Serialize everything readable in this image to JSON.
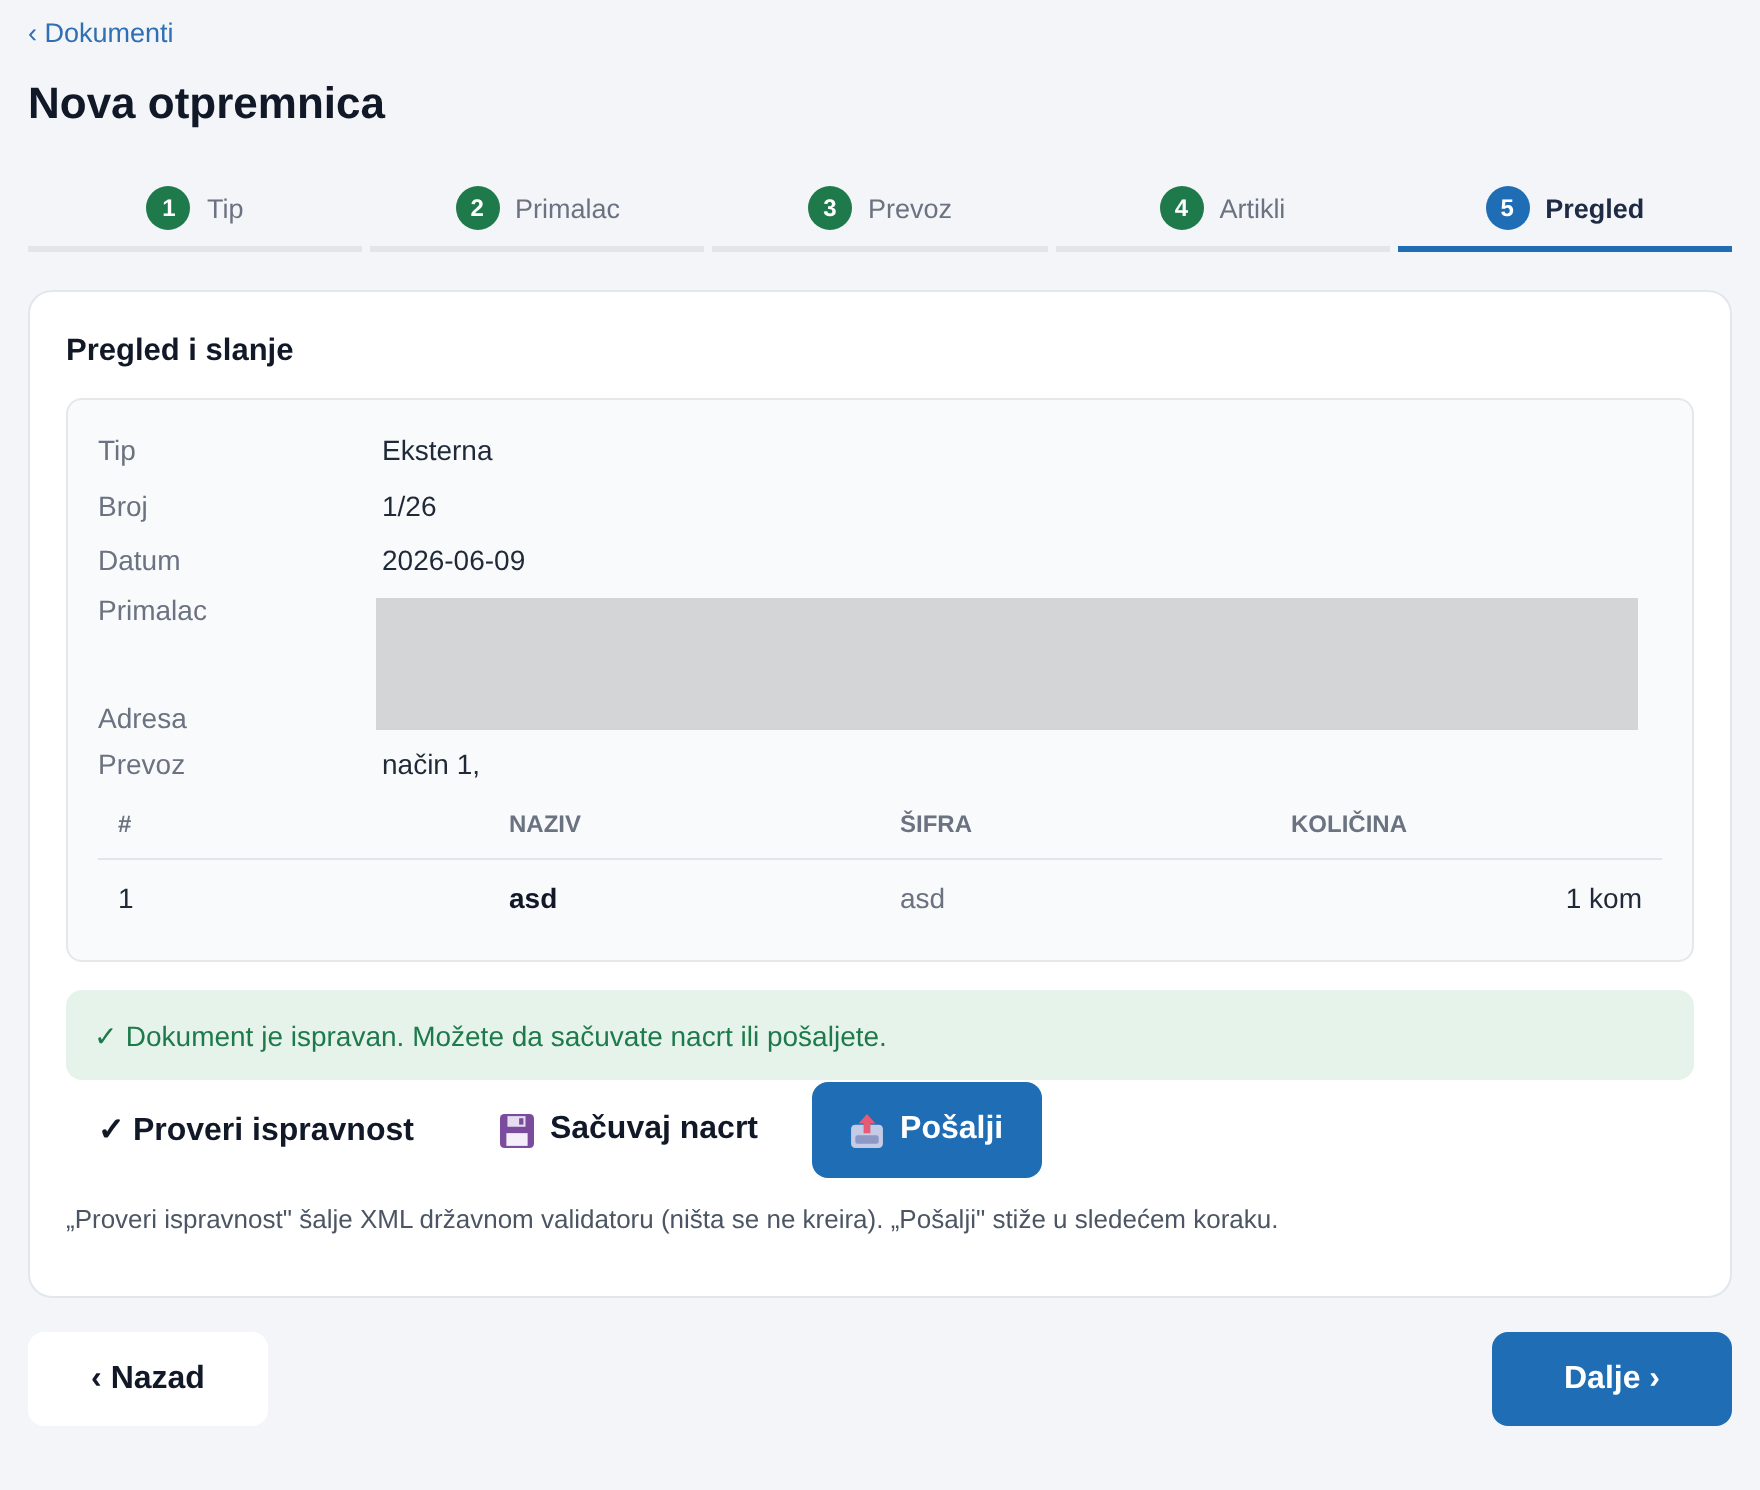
{
  "back_link": {
    "label": "‹ Dokumenti"
  },
  "title": "Nova otpremnica",
  "steps": [
    {
      "number": "1",
      "label": "Tip",
      "completed": true,
      "selected": false
    },
    {
      "number": "2",
      "label": "Primalac",
      "completed": true,
      "selected": false
    },
    {
      "number": "3",
      "label": "Prevoz",
      "completed": true,
      "selected": false
    },
    {
      "number": "4",
      "label": "Artikli",
      "completed": true,
      "selected": false
    },
    {
      "number": "5",
      "label": "Pregled",
      "completed": false,
      "selected": true
    }
  ],
  "card": {
    "title": "Pregled i slanje",
    "summary": [
      {
        "label": "Tip",
        "value": "Eksterna",
        "redacted": false
      },
      {
        "label": "Broj",
        "value": "1/26",
        "redacted": false
      },
      {
        "label": "Datum",
        "value": "2026-06-09",
        "redacted": false
      },
      {
        "label": "Primalac",
        "redacted": true
      },
      {
        "label": "Adresa",
        "redacted": true
      },
      {
        "label": "Prevoz",
        "value": "način 1,",
        "redacted": false
      }
    ],
    "table": {
      "columns": [
        "#",
        "NAZIV",
        "ŠIFRA",
        "KOLIČINA"
      ],
      "rows": [
        [
          "1",
          "asd",
          "asd",
          "1 kom"
        ]
      ]
    },
    "alert": {
      "kind": "success",
      "text": "✓ Dokument je ispravan. Možete da sačuvate nacrt ili pošaljete."
    },
    "actions": [
      {
        "kind": "validate",
        "label": "✓ Proveri ispravnost"
      },
      {
        "kind": "save",
        "label": "Sačuvaj nacrt"
      },
      {
        "kind": "send",
        "label": "Pošalji"
      }
    ],
    "note": "„Proveri ispravnost\" šalje XML državnom validatoru (ništa se ne kreira). „Pošalji\" stiže u sledećem koraku."
  },
  "footer": [
    {
      "kind": "back",
      "label": "‹ Nazad"
    },
    {
      "kind": "next",
      "label": "Dalje ›"
    }
  ]
}
